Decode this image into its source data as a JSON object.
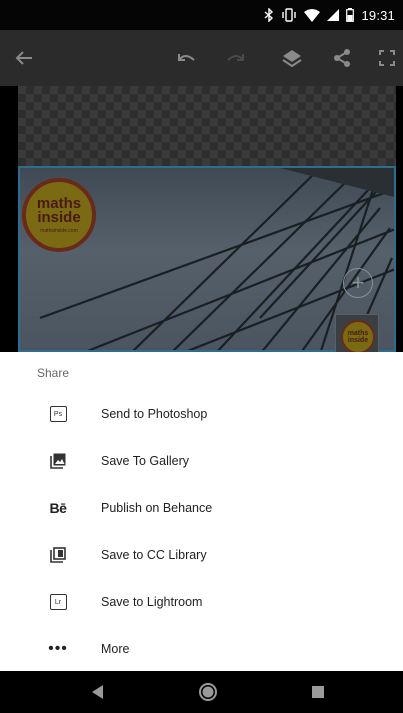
{
  "status_bar": {
    "time": "19:31",
    "icons": [
      "bluetooth-icon",
      "vibrate-icon",
      "wifi-icon",
      "signal-icon",
      "battery-icon"
    ]
  },
  "toolbar": {
    "icons": [
      "back-arrow-icon",
      "undo-icon",
      "redo-icon",
      "layers-icon",
      "share-icon",
      "fullscreen-icon"
    ]
  },
  "canvas": {
    "logo_line1": "maths",
    "logo_line2": "inside",
    "logo_line3": "mathsinside.com",
    "thumb_line1": "maths",
    "thumb_line2": "inside",
    "add_label": "+"
  },
  "share_sheet": {
    "title": "Share",
    "items": [
      {
        "label": "Send to Photoshop",
        "icon": "photoshop-icon",
        "icon_text": "Ps"
      },
      {
        "label": "Save To Gallery",
        "icon": "gallery-icon"
      },
      {
        "label": "Publish on Behance",
        "icon": "behance-icon",
        "icon_text": "Bē"
      },
      {
        "label": "Save to CC Library",
        "icon": "cc-library-icon"
      },
      {
        "label": "Save to Lightroom",
        "icon": "lightroom-icon",
        "icon_text": "Lr"
      },
      {
        "label": "More",
        "icon": "more-icon",
        "icon_text": "•••"
      }
    ]
  },
  "nav_bar": {
    "icons": [
      "nav-back-icon",
      "nav-home-icon",
      "nav-recents-icon"
    ]
  },
  "colors": {
    "sheet_bg": "#ffffff",
    "selection_border": "#2d6e8e",
    "toolbar_bg": "#2b2b2b"
  }
}
